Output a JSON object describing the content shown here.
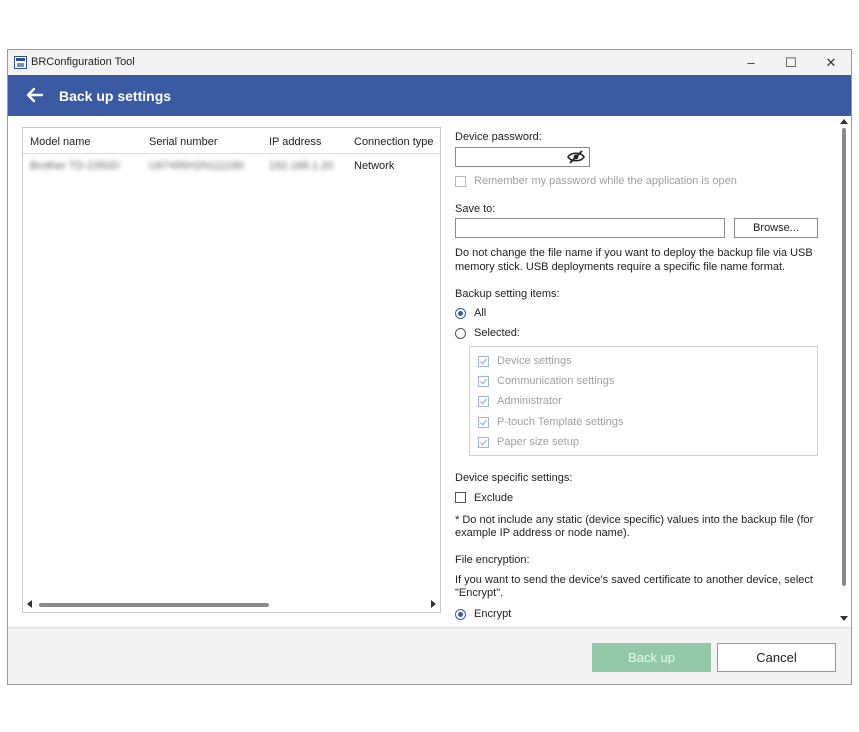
{
  "window": {
    "title": "BRConfiguration Tool",
    "controls": {
      "minimize": "–",
      "maximize": "☐",
      "close": "✕"
    }
  },
  "header": {
    "title": "Back up settings",
    "back_icon": "arrow-left-icon",
    "bg_color": "#3a5ba4"
  },
  "device_table": {
    "columns": [
      "Model name",
      "Serial number",
      "IP address",
      "Connection type"
    ],
    "rows": [
      {
        "model": "Brother TD-2350D",
        "serial": "U67495H2N111190",
        "ip": "192.168.1.20",
        "connection": "Network"
      }
    ]
  },
  "form": {
    "device_password": {
      "label": "Device password:",
      "value": "",
      "toggle_icon": "eye-hidden-icon"
    },
    "remember_password": {
      "label": "Remember my password while the application is open",
      "checked": false,
      "disabled": true
    },
    "save_to": {
      "label": "Save to:",
      "value": "",
      "browse_label": "Browse...",
      "hint_line1": "Do not change the file name if you want to deploy the backup file via USB",
      "hint_line2": "memory stick. USB deployments require a specific file name format."
    },
    "backup_items": {
      "label": "Backup setting items:",
      "selected_option": "All",
      "options": [
        "All",
        "Selected:"
      ],
      "items": [
        {
          "label": "Device settings",
          "checked": true
        },
        {
          "label": "Communication settings",
          "checked": true
        },
        {
          "label": "Administrator",
          "checked": true
        },
        {
          "label": "P-touch Template settings",
          "checked": true
        },
        {
          "label": "Paper size setup",
          "checked": true
        }
      ]
    },
    "device_specific": {
      "label": "Device specific settings:",
      "exclude_label": "Exclude",
      "exclude_checked": false,
      "note_line1": "* Do not include any static (device specific) values into the backup file (for",
      "note_line2": "example IP address or node name)."
    },
    "file_encryption": {
      "label": "File encryption:",
      "hint_line1": "If you want to send the device's saved certificate to another device, select",
      "hint_line2": "\"Encrypt\".",
      "encrypt_label": "Encrypt",
      "encrypt_selected": true
    }
  },
  "footer": {
    "backup_label": "Back up",
    "backup_color": "#93c9a9",
    "cancel_label": "Cancel"
  }
}
